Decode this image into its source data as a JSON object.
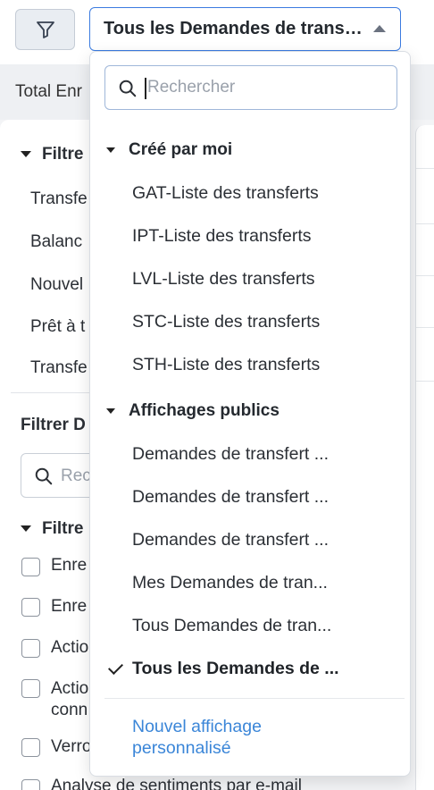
{
  "topbar": {
    "view_selected": "Tous les Demandes de transfert"
  },
  "background": {
    "total_label": "Total Enr",
    "filter_head_1": "Filtre",
    "quick_items": [
      "Transfe",
      "Balanc",
      "Nouvel",
      "Prêt à t",
      "Transfe"
    ],
    "filter_section_label": "Filtrer D",
    "search_placeholder": "Rec",
    "filter_head_2": "Filtre",
    "checkbox_items": [
      "Enre",
      "Enre",
      "Actio",
      "Actio",
      "conn",
      "Verro",
      "Analyse de sentiments par e-mail"
    ]
  },
  "dropdown": {
    "search_placeholder": "Rechercher",
    "groups": [
      {
        "title": "Créé par moi",
        "items": [
          "GAT-Liste des transferts",
          "IPT-Liste des transferts",
          "LVL-Liste des transferts",
          "STC-Liste des transferts",
          "STH-Liste des transferts"
        ]
      },
      {
        "title": "Affichages publics",
        "items": [
          "Demandes de transfert ...",
          "Demandes de transfert ...",
          "Demandes de transfert ...",
          "Mes Demandes de tran...",
          "Tous Demandes de tran...",
          "Tous les Demandes de ..."
        ]
      }
    ],
    "new_view": "Nouvel affichage personnalisé"
  },
  "colors": {
    "accent": "#3b7be0",
    "link": "#3b86d8"
  },
  "icons": {
    "filter": "funnel-icon",
    "search": "search-icon",
    "caret": "caret-up-icon",
    "check": "check-icon"
  }
}
